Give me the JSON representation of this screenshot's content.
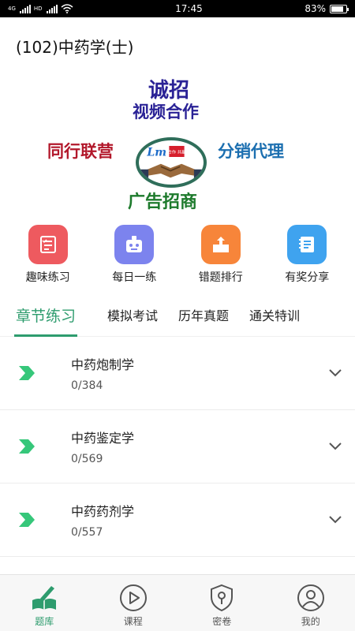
{
  "status_bar": {
    "signal1_tag": "4G",
    "signal2_tag": "HD",
    "time": "17:45",
    "battery_percent": "83%",
    "battery_level": 0.83
  },
  "header": {
    "title": "(102)中药学(士)"
  },
  "banner": {
    "line1": "诚招",
    "line2": "视频合作",
    "left": "同行联营",
    "right": "分销代理",
    "bottom": "广告招商",
    "logo_text": "合作 共赢"
  },
  "quick_actions": [
    {
      "label": "趣味练习",
      "icon": "quiz-sheet-icon",
      "color": "#ee5a5f"
    },
    {
      "label": "每日一练",
      "icon": "robot-face-icon",
      "color": "#7c83ee"
    },
    {
      "label": "错题排行",
      "icon": "ranking-box-icon",
      "color": "#f7853a"
    },
    {
      "label": "有奖分享",
      "icon": "notebook-icon",
      "color": "#3fa3ef"
    }
  ],
  "tabs": [
    {
      "label": "章节练习",
      "active": true
    },
    {
      "label": "模拟考试",
      "active": false
    },
    {
      "label": "历年真题",
      "active": false
    },
    {
      "label": "通关特训",
      "active": false
    }
  ],
  "chapters": [
    {
      "title": "中药炮制学",
      "progress": "0/384"
    },
    {
      "title": "中药鉴定学",
      "progress": "0/569"
    },
    {
      "title": "中药药剂学",
      "progress": "0/557"
    }
  ],
  "bottom_nav": [
    {
      "label": "题库",
      "icon": "book-pen-icon",
      "active": true
    },
    {
      "label": "课程",
      "icon": "play-circle-icon",
      "active": false
    },
    {
      "label": "密卷",
      "icon": "lock-shield-icon",
      "active": false
    },
    {
      "label": "我的",
      "icon": "user-circle-icon",
      "active": false
    }
  ],
  "colors": {
    "accent": "#2e9c6e",
    "flag": "#36c77a"
  }
}
